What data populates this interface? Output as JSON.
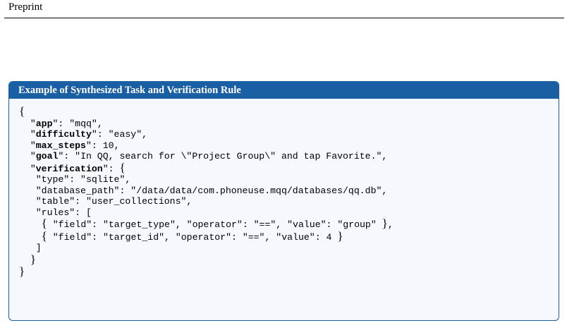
{
  "header": {
    "text": "Preprint"
  },
  "box": {
    "title": "Example of Synthesized Task and Verification Rule",
    "border_color": "#1a5fa3",
    "background_color": "#f5f8fc"
  },
  "code": {
    "app": {
      "key": "app",
      "value": "\"mqq\""
    },
    "difficulty": {
      "key": "difficulty",
      "value": "\"easy\""
    },
    "max_steps": {
      "key": "max_steps",
      "value": "10"
    },
    "goal": {
      "key": "goal",
      "value": "\"In QQ, search for \\\"Project Group\\\" and tap Favorite.\""
    },
    "verification": {
      "key": "verification",
      "type_line": "\"type\": \"sqlite\",",
      "database_path_line": "\"database_path\": \"/data/data/com.phoneuse.mqq/databases/qq.db\",",
      "table_line": "\"table\": \"user_collections\",",
      "rules_open_line": "\"rules\": [",
      "rules": [
        "\"field\": \"target_type\", \"operator\": \"==\", \"value\": \"group\"",
        "\"field\": \"target_id\", \"operator\": \"==\", \"value\": 4"
      ]
    }
  }
}
